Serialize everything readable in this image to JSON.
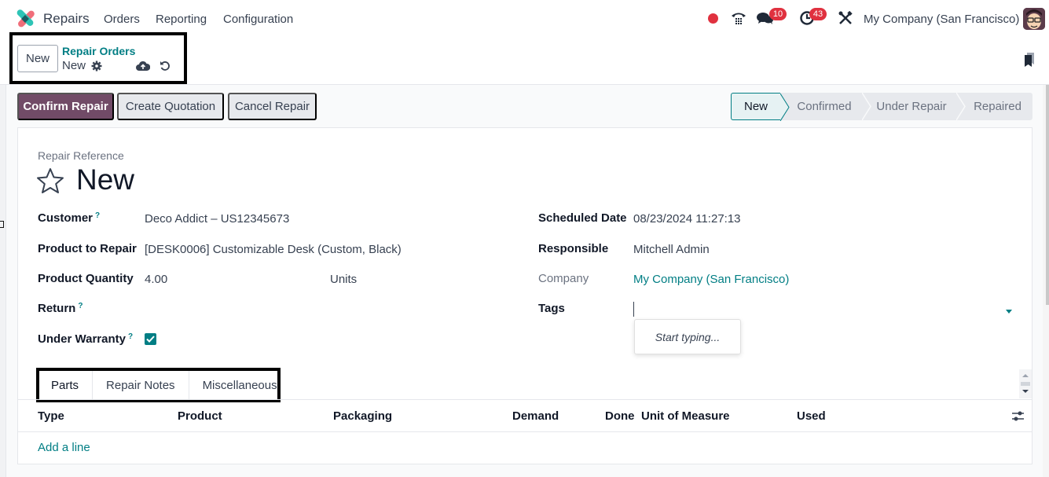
{
  "navbar": {
    "app_name": "Repairs",
    "menu": [
      "Orders",
      "Reporting",
      "Configuration"
    ],
    "icons": {
      "recording": "record-dot-icon",
      "phone": "phone-icon",
      "messages": "chat-icon",
      "activities": "clock-icon",
      "debug": "tools-icon"
    },
    "messages_count": "10",
    "activities_count": "43",
    "company": "My Company (San Francisco)",
    "brand_color": "#714b67",
    "badge_color": "#e0313f"
  },
  "control_panel": {
    "new_button": "New",
    "breadcrumb_parent": "Repair Orders",
    "breadcrumb_current": "New",
    "icons": [
      "gear-icon",
      "cloud-upload-icon",
      "undo-icon"
    ]
  },
  "actions": {
    "confirm": "Confirm Repair",
    "quotation": "Create Quotation",
    "cancel": "Cancel Repair"
  },
  "statusbar": {
    "stages": [
      "New",
      "Confirmed",
      "Under Repair",
      "Repaired"
    ],
    "active": "New"
  },
  "form": {
    "reference_label": "Repair Reference",
    "record_name": "New",
    "left_fields": [
      {
        "label": "Customer",
        "help": "?",
        "value": "Deco Addict – US12345673"
      },
      {
        "label": "Product to Repair",
        "value": "[DESK0006] Customizable Desk (Custom, Black)"
      },
      {
        "label": "Product Quantity",
        "value": "4.00",
        "unit": "Units"
      },
      {
        "label": "Return",
        "help": "?",
        "value": ""
      },
      {
        "label": "Under Warranty",
        "help": "?",
        "checked": true
      }
    ],
    "right_fields": [
      {
        "label": "Scheduled Date",
        "value": "08/23/2024 11:27:13"
      },
      {
        "label": "Responsible",
        "value": "Mitchell Admin"
      },
      {
        "label": "Company",
        "value": "My Company (San Francisco)"
      },
      {
        "label": "Tags",
        "value": ""
      }
    ],
    "tags_autocomplete": "Start typing..."
  },
  "notebook": {
    "tabs": [
      "Parts",
      "Repair Notes",
      "Miscellaneous"
    ],
    "active_tab": "Parts"
  },
  "parts_table": {
    "columns": [
      "Type",
      "Product",
      "Packaging",
      "Demand",
      "Done",
      "Unit of Measure",
      "Used"
    ],
    "add_line": "Add a line"
  },
  "accent_color": "#017e84"
}
